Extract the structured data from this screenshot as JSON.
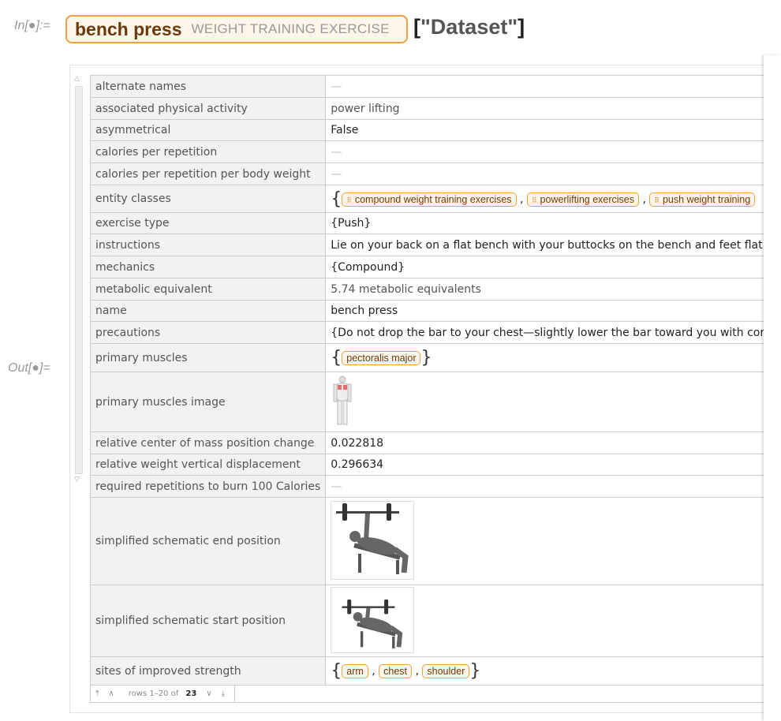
{
  "input": {
    "label": "In[●]:=",
    "entity_name": "bench press",
    "entity_type": "WEIGHT TRAINING EXERCISE",
    "suffix_open": "[",
    "suffix_arg": "\"Dataset\"",
    "suffix_close": "]"
  },
  "output": {
    "label": "Out[●]="
  },
  "rows": [
    {
      "key": "alternate names",
      "value": "—"
    },
    {
      "key": "associated physical activity",
      "value": "power lifting"
    },
    {
      "key": "asymmetrical",
      "value": "False"
    },
    {
      "key": "calories per repetition",
      "value": "—"
    },
    {
      "key": "calories per repetition per body weight",
      "value": "—"
    },
    {
      "key": "entity classes",
      "items": [
        "compound weight training exercises",
        "powerlifting exercises",
        "push weight training"
      ]
    },
    {
      "key": "exercise type",
      "value": "{Push}"
    },
    {
      "key": "instructions",
      "value": "Lie on your back on a flat bench with your buttocks on the bench and feet flat on the fl"
    },
    {
      "key": "mechanics",
      "value": "{Compound}"
    },
    {
      "key": "metabolic equivalent",
      "value": "5.74",
      "unit": "metabolic equivalents"
    },
    {
      "key": "name",
      "value": "bench press"
    },
    {
      "key": "precautions",
      "value": "{Do not drop the bar to your chest—slightly lower the bar toward you with control., If"
    },
    {
      "key": "primary muscles",
      "items": [
        "pectoralis major"
      ]
    },
    {
      "key": "primary muscles image"
    },
    {
      "key": "relative center of mass position change",
      "value": "0.022818"
    },
    {
      "key": "relative weight vertical displacement",
      "value": "0.296634"
    },
    {
      "key": "required repetitions to burn 100 Calories",
      "value": "—"
    },
    {
      "key": "simplified schematic end position"
    },
    {
      "key": "simplified schematic start position"
    },
    {
      "key": "sites of improved strength",
      "items": [
        "arm",
        "chest",
        "shoulder"
      ]
    }
  ],
  "footer": {
    "rows_text": "rows 1–20 of",
    "total": "23"
  },
  "colors": {
    "accent": "#f0a040",
    "entity_text": "#6b3a0c"
  }
}
